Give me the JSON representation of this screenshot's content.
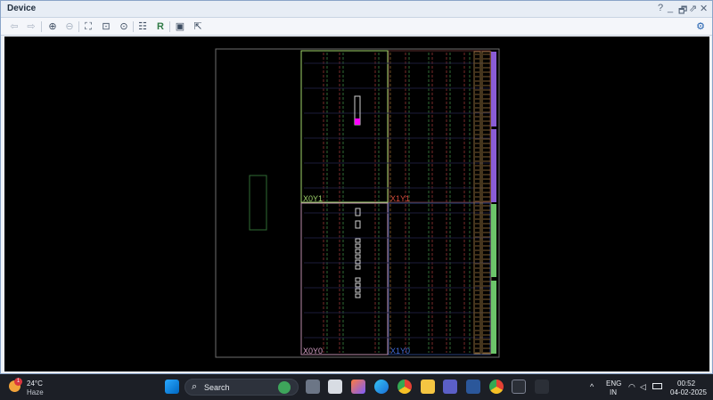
{
  "window": {
    "title": "Device"
  },
  "window_controls": {
    "help": "?",
    "minimize": "_",
    "restore": "🗗",
    "float": "⇗",
    "close": "✕"
  },
  "toolbar": {
    "back": "⇦",
    "forward": "⇨",
    "zoom_in": "⊕",
    "zoom_out": "⊖",
    "zoom_fit": "⛶",
    "zoom_area": "⊡",
    "select": "⊙",
    "grid": "☷",
    "route": "R",
    "layout": "▣",
    "relocate": "⇱",
    "settings": "⚙"
  },
  "device": {
    "region_labels": {
      "x0y1": "X0Y1",
      "x1y1": "X1Y1",
      "x0y0": "X0Y0",
      "x1y0": "X1Y0"
    },
    "colors": {
      "x0y1": "#9fd46a",
      "x1y1": "#d24a3a",
      "x0y0": "#d7a1c7",
      "x1y0": "#3f6ad8",
      "highlight": "#ff00ff",
      "purple_bank": "#8a5cd6",
      "green_bank": "#6cc46a"
    }
  },
  "taskbar": {
    "weather": {
      "temp": "24°C",
      "condition": "Haze",
      "badge": "1"
    },
    "search": {
      "placeholder": "Search"
    },
    "tray": {
      "language": "ENG",
      "region": "IN",
      "time": "00:52",
      "date": "04-02-2025",
      "chevron": "^"
    }
  }
}
